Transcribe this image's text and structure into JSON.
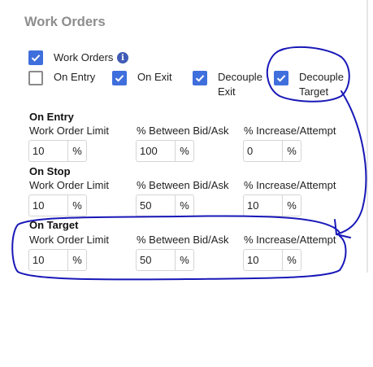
{
  "header": {
    "title": "Work Orders"
  },
  "options": {
    "work_orders": {
      "label": "Work Orders",
      "checked": true
    },
    "on_entry": {
      "label": "On Entry",
      "checked": false
    },
    "on_exit": {
      "label": "On Exit",
      "checked": true
    },
    "decouple_exit": {
      "label_line1": "Decouple",
      "label_line2": "Exit",
      "checked": true
    },
    "decouple_target": {
      "label_line1": "Decouple",
      "label_line2": "Target",
      "checked": true
    }
  },
  "info_icon": {
    "name": "info-icon",
    "glyph": "i"
  },
  "columns": {
    "limit": "Work Order Limit",
    "between": "% Between Bid/Ask",
    "increase": "% Increase/Attempt"
  },
  "sections": [
    {
      "title": "On Entry",
      "limit": "10",
      "between": "100",
      "increase": "0",
      "unit": "%"
    },
    {
      "title": "On Stop",
      "limit": "10",
      "between": "50",
      "increase": "10",
      "unit": "%"
    },
    {
      "title": "On Target",
      "limit": "10",
      "between": "50",
      "increase": "10",
      "unit": "%"
    }
  ],
  "annotation": {
    "ink_color": "#1818b8",
    "description": "hand-drawn loop around Decouple Target with arrow to On Target section"
  },
  "colors": {
    "accent": "#3f6fdc",
    "title": "#8d8d8d",
    "border": "#d5d5d5"
  }
}
